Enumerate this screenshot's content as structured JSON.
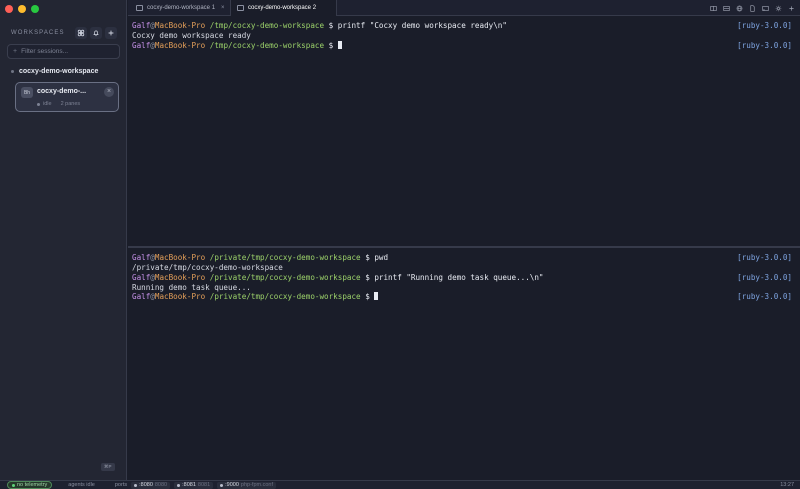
{
  "sidebar": {
    "title": "WORKSPACES",
    "filter_placeholder": "Filter sessions...",
    "group_label": "cocxy-demo-workspace",
    "card": {
      "thumb": "Bh",
      "title": "cocxy-demo-...",
      "status": "idle",
      "panes": "2 panes",
      "close": "×"
    },
    "shortcut": "⌘P"
  },
  "tabs": [
    {
      "label": "cocxy-demo-workspace 1",
      "close": "×"
    },
    {
      "label": "cocxy-demo-workspace 2"
    }
  ],
  "pane1": {
    "lines": [
      {
        "user": "Galf",
        "at": "@",
        "host": "MacBook-Pro",
        "path": " /tmp/cocxy-demo-workspace",
        "prompt": " $ ",
        "cmd": "printf \"Cocxy demo workspace ready\\n\"",
        "ruby": "[ruby-3.0.0]"
      },
      {
        "output": "Cocxy demo workspace ready"
      },
      {
        "user": "Galf",
        "at": "@",
        "host": "MacBook-Pro",
        "path": " /tmp/cocxy-demo-workspace",
        "prompt": " $ ",
        "ruby": "[ruby-3.0.0]"
      }
    ]
  },
  "pane2": {
    "lines": [
      {
        "user": "Galf",
        "at": "@",
        "host": "MacBook-Pro",
        "path": " /private/tmp/cocxy-demo-workspace",
        "prompt": " $ ",
        "cmd": "pwd",
        "ruby": "[ruby-3.0.0]"
      },
      {
        "output": "/private/tmp/cocxy-demo-workspace"
      },
      {
        "user": "Galf",
        "at": "@",
        "host": "MacBook-Pro",
        "path": " /private/tmp/cocxy-demo-workspace",
        "prompt": " $ ",
        "cmd": "printf \"Running demo task queue...\\n\"",
        "ruby": "[ruby-3.0.0]"
      },
      {
        "output": "Running demo task queue..."
      },
      {
        "user": "Galf",
        "at": "@",
        "host": "MacBook-Pro",
        "path": " /private/tmp/cocxy-demo-workspace",
        "prompt": " $ ",
        "ruby": "[ruby-3.0.0]"
      }
    ]
  },
  "statusbar": {
    "telemetry": "no telemetry",
    "agents": "agents idle",
    "ports_label": "ports",
    "ports": [
      {
        "name": ":8080",
        "value": "8080"
      },
      {
        "name": ":8081",
        "value": "8081"
      },
      {
        "name": ":9000",
        "value": "php-fpm.conf"
      }
    ],
    "time": "13:27"
  },
  "colors": {
    "background": "#1a1d29",
    "sidebar": "#232633",
    "user": "#c792ea",
    "host": "#e5a05a",
    "path": "#9cd26a",
    "ruby": "#7ea4e0",
    "telemetry_ok": "#5fd17a"
  }
}
